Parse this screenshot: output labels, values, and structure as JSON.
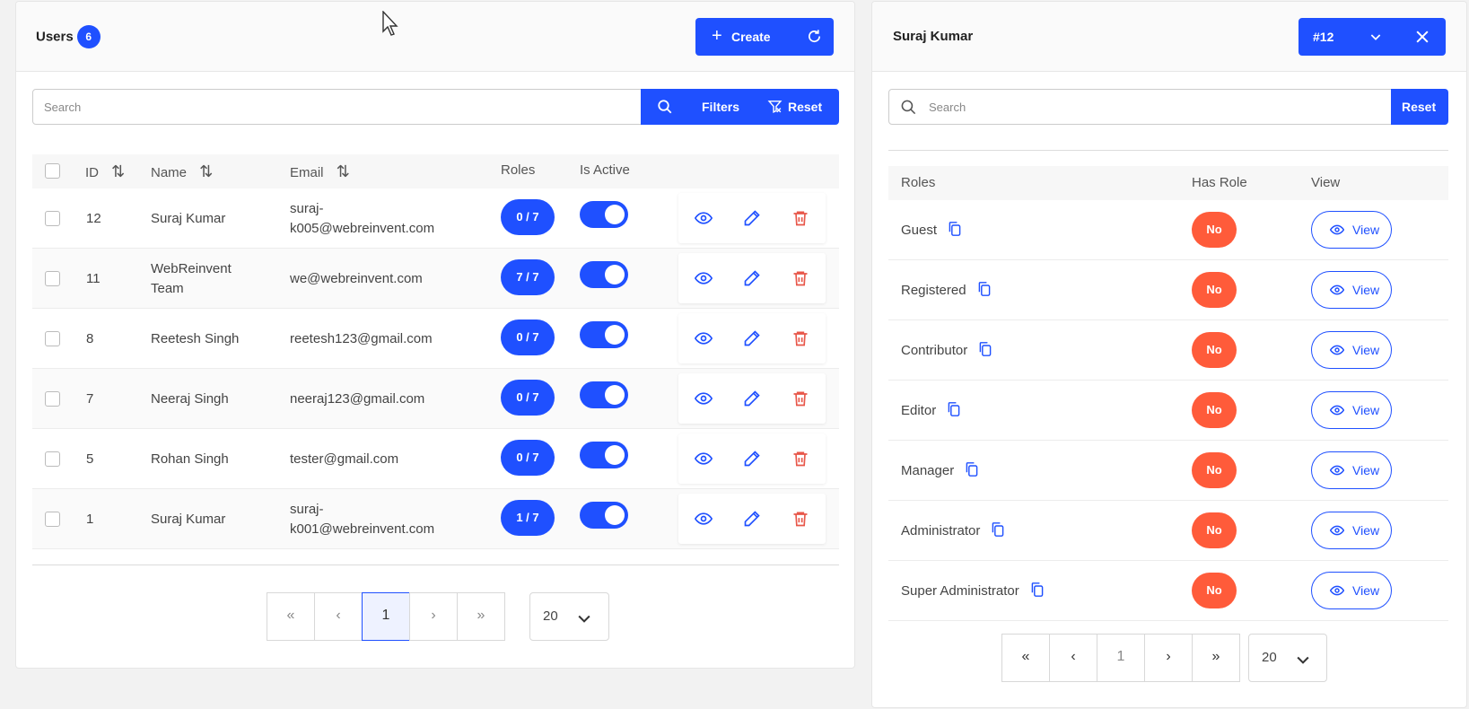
{
  "users_panel": {
    "title": "Users",
    "count": "6",
    "create_label": "Create",
    "search_placeholder": "Search",
    "filters_label": "Filters",
    "reset_label": "Reset",
    "columns": {
      "id": "ID",
      "name": "Name",
      "email": "Email",
      "roles": "Roles",
      "is_active": "Is Active"
    },
    "rows": [
      {
        "id": "12",
        "name": "Suraj Kumar",
        "email": "suraj-\nk005@webreinvent.com",
        "roles": "0 / 7",
        "active": true
      },
      {
        "id": "11",
        "name": "WebReinvent\nTeam",
        "email": "we@webreinvent.com",
        "roles": "7 / 7",
        "active": true
      },
      {
        "id": "8",
        "name": "Reetesh Singh",
        "email": "reetesh123@gmail.com",
        "roles": "0 / 7",
        "active": true
      },
      {
        "id": "7",
        "name": "Neeraj Singh",
        "email": "neeraj123@gmail.com",
        "roles": "0 / 7",
        "active": true
      },
      {
        "id": "5",
        "name": "Rohan Singh",
        "email": "tester@gmail.com",
        "roles": "0 / 7",
        "active": true
      },
      {
        "id": "1",
        "name": "Suraj Kumar",
        "email": "suraj-\nk001@webreinvent.com",
        "roles": "1 / 7",
        "active": true
      }
    ],
    "pagination": {
      "first": "«",
      "prev": "‹",
      "current": "1",
      "next": "›",
      "last": "»",
      "per_page": "20"
    }
  },
  "detail_panel": {
    "title": "Suraj Kumar",
    "record_id": "#12",
    "search_placeholder": "Search",
    "reset_label": "Reset",
    "columns": {
      "roles": "Roles",
      "has_role": "Has Role",
      "view": "View"
    },
    "roles": [
      {
        "name": "Guest",
        "has_role": "No",
        "view": "View"
      },
      {
        "name": "Registered",
        "has_role": "No",
        "view": "View"
      },
      {
        "name": "Contributor",
        "has_role": "No",
        "view": "View"
      },
      {
        "name": "Editor",
        "has_role": "No",
        "view": "View"
      },
      {
        "name": "Manager",
        "has_role": "No",
        "view": "View"
      },
      {
        "name": "Administrator",
        "has_role": "No",
        "view": "View"
      },
      {
        "name": "Super Administrator",
        "has_role": "No",
        "view": "View"
      }
    ],
    "pagination": {
      "first": "«",
      "prev": "‹",
      "current": "1",
      "next": "›",
      "last": "»",
      "per_page": "20"
    }
  },
  "colors": {
    "primary": "#1f50ff",
    "danger": "#ff5b3a",
    "delete_icon": "#e8574a"
  }
}
